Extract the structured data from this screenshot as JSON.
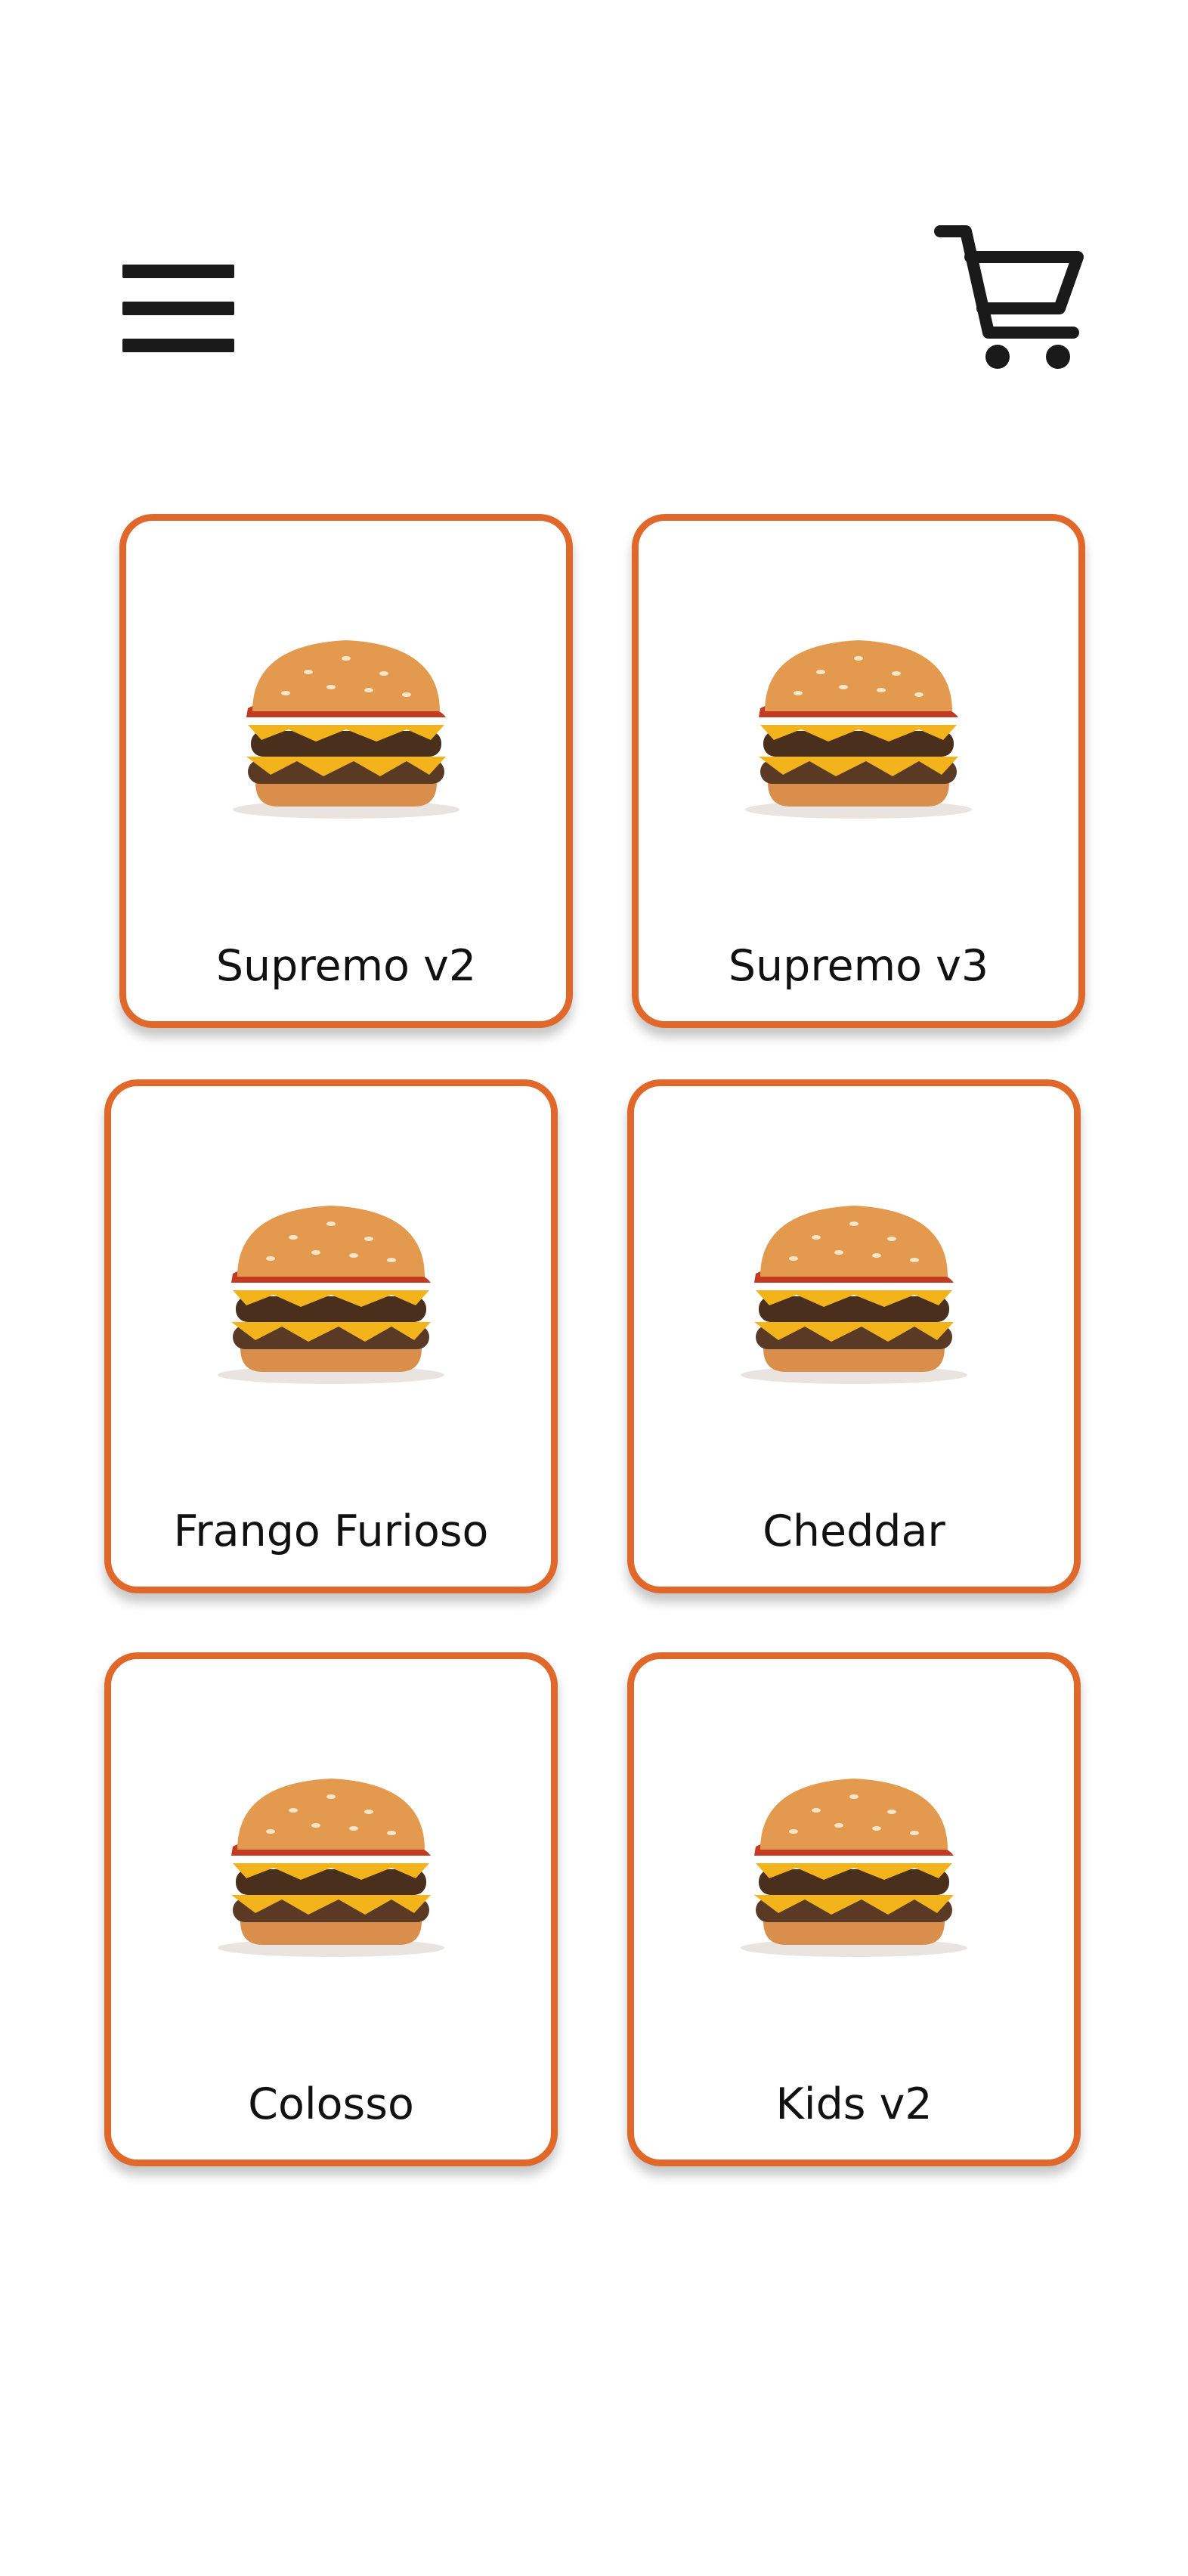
{
  "header": {
    "menu_icon": "hamburger-menu-icon",
    "cart_icon": "shopping-cart-icon"
  },
  "colors": {
    "card_border": "#e0682a",
    "icon": "#1a1a1a",
    "text": "#111111"
  },
  "products": [
    {
      "name": "Supremo v2",
      "image": "burger-image"
    },
    {
      "name": "Supremo v3",
      "image": "burger-image"
    },
    {
      "name": "Frango Furioso",
      "image": "chicken-burger-image"
    },
    {
      "name": "Cheddar",
      "image": "burger-image"
    },
    {
      "name": "Colosso",
      "image": "burger-image"
    },
    {
      "name": "Kids v2",
      "image": "burger-image"
    }
  ]
}
